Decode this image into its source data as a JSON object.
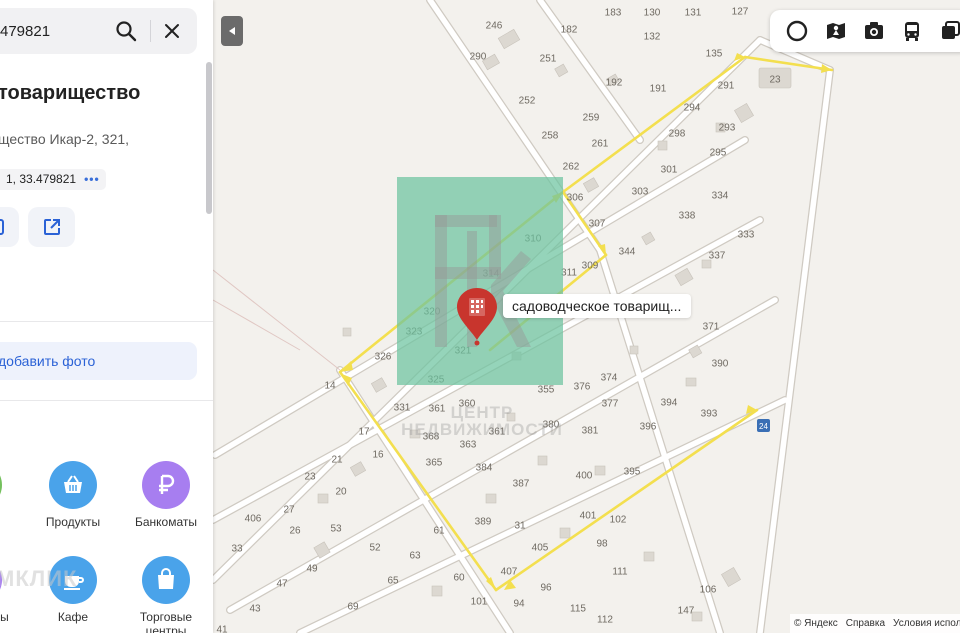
{
  "search": {
    "value": "479821"
  },
  "place": {
    "title": "товарищество",
    "address": "щество Икар-2, 321,",
    "coords": "1, 33.479821"
  },
  "panel": {
    "add_photo_label": "добавить фото",
    "categories": [
      {
        "label": "Продукты",
        "icon": "basket-icon",
        "color": "#4aa3ea"
      },
      {
        "label": "Банкоматы",
        "icon": "ruble-icon",
        "color": "#a77ef0"
      },
      {
        "label": "Кафе",
        "icon": "cup-icon",
        "color": "#4aa3ea"
      },
      {
        "label": "Торговые центры",
        "icon": "shopping-bag-icon",
        "color": "#4aa3ea"
      },
      {
        "label": "ды",
        "icon": "",
        "color": "#a77ef0"
      }
    ],
    "ghost_text": "МКЛИК"
  },
  "map": {
    "pin_label": "садоводческое товарищ...",
    "watermark_text": "ЦЕНТР\nНЕДВИЖИМОСТИ",
    "plot_numbers": [
      "246",
      "183",
      "130",
      "131",
      "127",
      "290",
      "182",
      "132",
      "251",
      "135",
      "23",
      "192",
      "191",
      "291",
      "252",
      "259",
      "294",
      "298",
      "293",
      "261",
      "295",
      "258",
      "262",
      "301",
      "306",
      "303",
      "334",
      "307",
      "338",
      "310",
      "333",
      "344",
      "337",
      "309",
      "314",
      "311",
      "320",
      "323",
      "371",
      "326",
      "321",
      "390",
      "325",
      "374",
      "14",
      "331",
      "361",
      "360",
      "376",
      "394",
      "355",
      "377",
      "393",
      "17",
      "368",
      "380",
      "396",
      "16",
      "363",
      "361",
      "381",
      "21",
      "365",
      "384",
      "400",
      "395",
      "23",
      "387",
      "20",
      "401",
      "102",
      "27",
      "389",
      "406",
      "31",
      "53",
      "26",
      "405",
      "98",
      "33",
      "52",
      "63",
      "407",
      "111",
      "49",
      "61",
      "60",
      "96",
      "106",
      "65",
      "101",
      "94",
      "115",
      "147",
      "47",
      "43",
      "69",
      "112",
      "41"
    ]
  },
  "copyright": {
    "yandex": "© Яндекс",
    "help": "Справка",
    "terms": "Условия исполь"
  },
  "colors": {
    "route": "#f3df4f",
    "pin": "#c8352d",
    "watermark": "#6cc4a0",
    "link": "#2b62d6"
  }
}
